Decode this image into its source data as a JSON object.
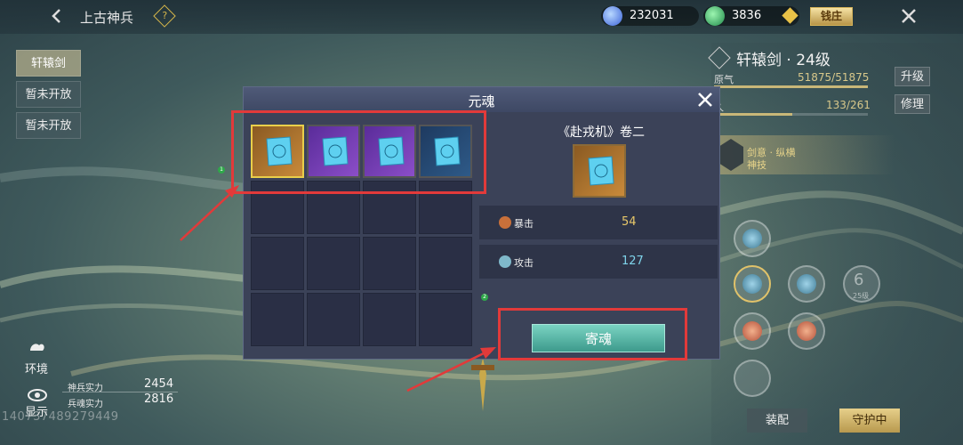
{
  "header": {
    "title": "上古神兵",
    "currency_1": "232031",
    "currency_2": "3836",
    "qianzhuang": "钱庄"
  },
  "left_menu": {
    "items": [
      {
        "label": "轩辕剑",
        "active": true
      },
      {
        "label": "暂未开放",
        "active": false
      },
      {
        "label": "暂未开放",
        "active": false
      }
    ],
    "env_label": "环境",
    "show_label": "显示"
  },
  "stats": {
    "shenbing_label": "神兵实力",
    "shenbing_value": "2454",
    "bingpo_label": "兵魂实力",
    "bingpo_value": "2816"
  },
  "uid": "140737489279449",
  "right_panel": {
    "weapon_title": "轩辕剑 · 24级",
    "attr1_label": "原气",
    "attr1_value": "51875/51875",
    "attr1_fill": 1.0,
    "attr2_label": "久",
    "attr2_value": "133/261",
    "attr2_fill": 0.51,
    "upgrade_label": "升级",
    "repair_label": "修理",
    "skill_name": "剑意 · 纵横",
    "skill_sub": "神技",
    "lock_num": "6",
    "lock_sub": "25级",
    "equip_label": "装配",
    "guard_label": "守护中"
  },
  "modal": {
    "title": "元魂",
    "detail_title": "《赴戎机》卷二",
    "stats": [
      {
        "name": "暴击",
        "value": "54",
        "color": "#e8c86a"
      },
      {
        "name": "攻击",
        "value": "127",
        "color": "#7fd3ea"
      }
    ],
    "action_label": "寄魂",
    "items": [
      {
        "rarity": "orange",
        "selected": true
      },
      {
        "rarity": "purple",
        "selected": false
      },
      {
        "rarity": "purple",
        "selected": false
      },
      {
        "rarity": "blue",
        "selected": false
      }
    ],
    "badge_1": "1",
    "badge_2": "2"
  },
  "colors": {
    "highlight": "#e23a3a",
    "gold": "#e9cf4a",
    "modal_bg": "#3b4258"
  }
}
